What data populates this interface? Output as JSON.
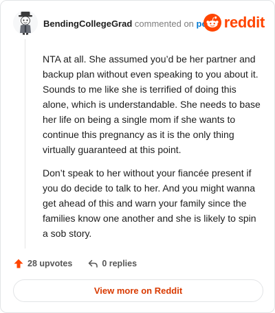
{
  "header": {
    "username": "BendingCollegeGrad",
    "verb": "commented on",
    "post_link": "post",
    "brand": "reddit"
  },
  "comment": {
    "paragraphs": [
      "NTA at all. She assumed you’d be her partner and backup plan without even speaking to you about it. Sounds to me like she is terrified of doing this alone, which is understandable. She needs to base her life on being a single mom if she wants to continue this pregnancy as it is the only thing virtually guaranteed at this point.",
      "Don’t speak to her without your fiancée present if you do decide to talk to her. And you might wanna get ahead of this and warn your family since the families know one another and she is likely to spin a sob story."
    ]
  },
  "actions": {
    "upvotes": "28 upvotes",
    "replies": "0 replies"
  },
  "footer": {
    "view_more": "View more on Reddit"
  },
  "colors": {
    "brand": "#ff4500",
    "link": "#0079d3",
    "cta": "#d93a00"
  },
  "icons": {
    "avatar": "user-avatar",
    "brand": "reddit-alien-icon",
    "upvote": "upvote-arrow-icon",
    "reply": "reply-arrow-icon"
  }
}
